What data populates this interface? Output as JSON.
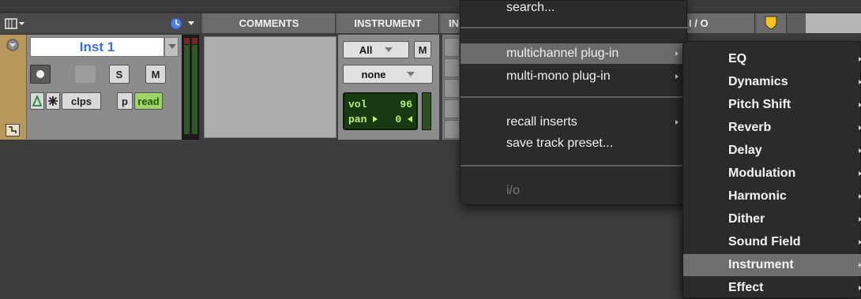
{
  "header": {
    "comments": "COMMENTS",
    "instrument": "INSTRUMENT",
    "inserts_partial": "IN",
    "io": "I / O"
  },
  "track": {
    "name": "Inst 1",
    "buttons": {
      "solo": "S",
      "mute": "M",
      "clips": "clps",
      "playlist": "p",
      "automation": "read"
    }
  },
  "instrument": {
    "midi_channel": "All",
    "mute_label": "M",
    "patch": "none",
    "volume_label": "vol",
    "volume_value": "96",
    "pan_label": "pan",
    "pan_value": "0"
  },
  "menu": {
    "search": "search...",
    "multichannel": "multichannel plug-in",
    "multimono": "multi-mono plug-in",
    "recall": "recall inserts",
    "save_preset": "save track preset...",
    "io": "i/o"
  },
  "submenu": {
    "items": [
      "EQ",
      "Dynamics",
      "Pitch Shift",
      "Reverb",
      "Delay",
      "Modulation",
      "Harmonic",
      "Dither",
      "Sound Field",
      "Instrument",
      "Effect"
    ],
    "highlighted": "Instrument"
  },
  "colors": {
    "track_accent": "#b8975c",
    "track_name": "#3b6fd6",
    "automation_read": "#9ed36b",
    "lcd_text": "#b8f07a",
    "menu_bg": "#2b2b2b",
    "menu_highlight": "#6b6b6b"
  }
}
